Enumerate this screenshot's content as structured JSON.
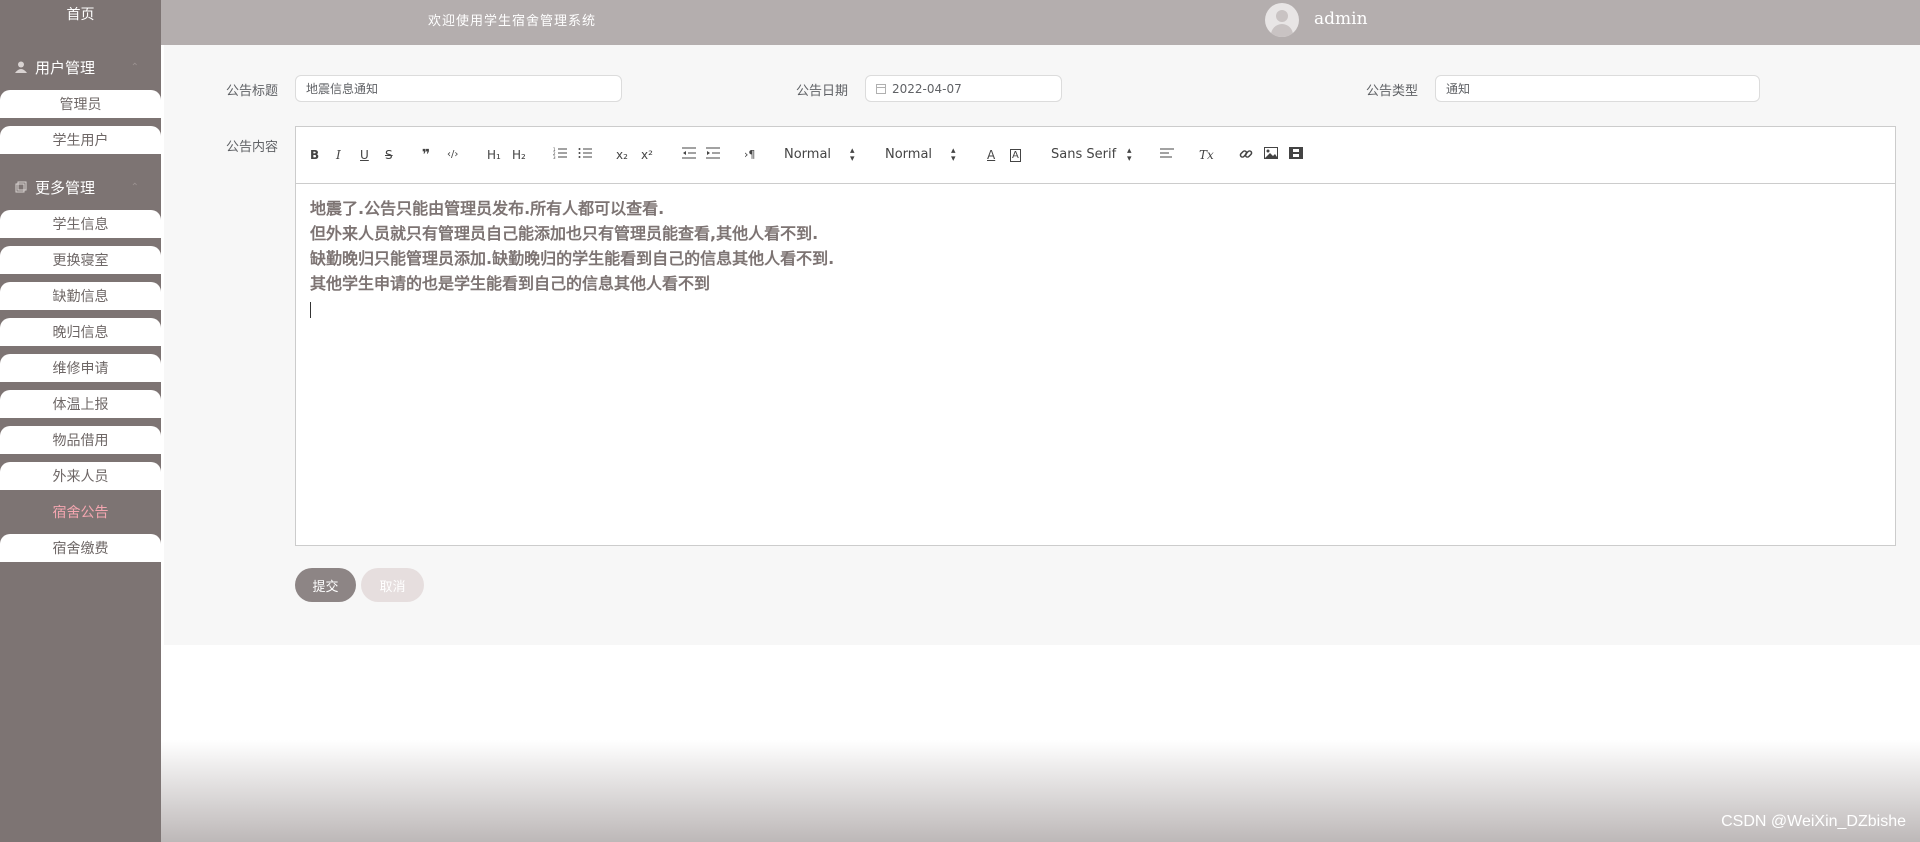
{
  "sidebar": {
    "home": "首页",
    "groups": [
      {
        "title": "用户管理",
        "icon": "user-icon",
        "items": [
          {
            "label": "管理员"
          },
          {
            "label": "学生用户"
          }
        ]
      },
      {
        "title": "更多管理",
        "icon": "layers-icon",
        "items": [
          {
            "label": "学生信息"
          },
          {
            "label": "更换寝室"
          },
          {
            "label": "缺勤信息"
          },
          {
            "label": "晚归信息"
          },
          {
            "label": "维修申请"
          },
          {
            "label": "体温上报"
          },
          {
            "label": "物品借用"
          },
          {
            "label": "外来人员"
          },
          {
            "label": "宿舍公告",
            "active": true
          },
          {
            "label": "宿舍缴费"
          }
        ]
      }
    ]
  },
  "header": {
    "welcome": "欢迎使用学生宿舍管理系统",
    "username": "admin"
  },
  "form": {
    "title_label": "公告标题",
    "title_value": "地震信息通知",
    "date_label": "公告日期",
    "date_value": "2022-04-07",
    "type_label": "公告类型",
    "type_value": "通知",
    "content_label": "公告内容",
    "content_lines": [
      "地震了.公告只能由管理员发布.所有人都可以查看.",
      "但外来人员就只有管理员自己能添加也只有管理员能查看,其他人看不到.",
      "缺勤晚归只能管理员添加.缺勤晚归的学生能看到自己的信息其他人看不到.",
      "其他学生申请的也是学生能看到自己的信息其他人看不到"
    ]
  },
  "toolbar": {
    "bold": "B",
    "italic": "I",
    "underline": "U",
    "strike": "S",
    "blockquote": "❞",
    "code": "‹/›",
    "h1": "H₁",
    "h2": "H₂",
    "sub": "x₂",
    "sup": "x²",
    "direction": "›¶",
    "size_picker": "Normal",
    "header_picker": "Normal",
    "font_picker": "Sans Serif",
    "clean": "Tx"
  },
  "buttons": {
    "submit": "提交",
    "cancel": "取消"
  },
  "watermark": "CSDN @WeiXin_DZbishe",
  "colors": {
    "sidebar": "#7d7473",
    "header": "#b4aeae",
    "active_menu": "#f4a6b0",
    "submit": "#8d8585",
    "cancel": "#e6dede"
  }
}
